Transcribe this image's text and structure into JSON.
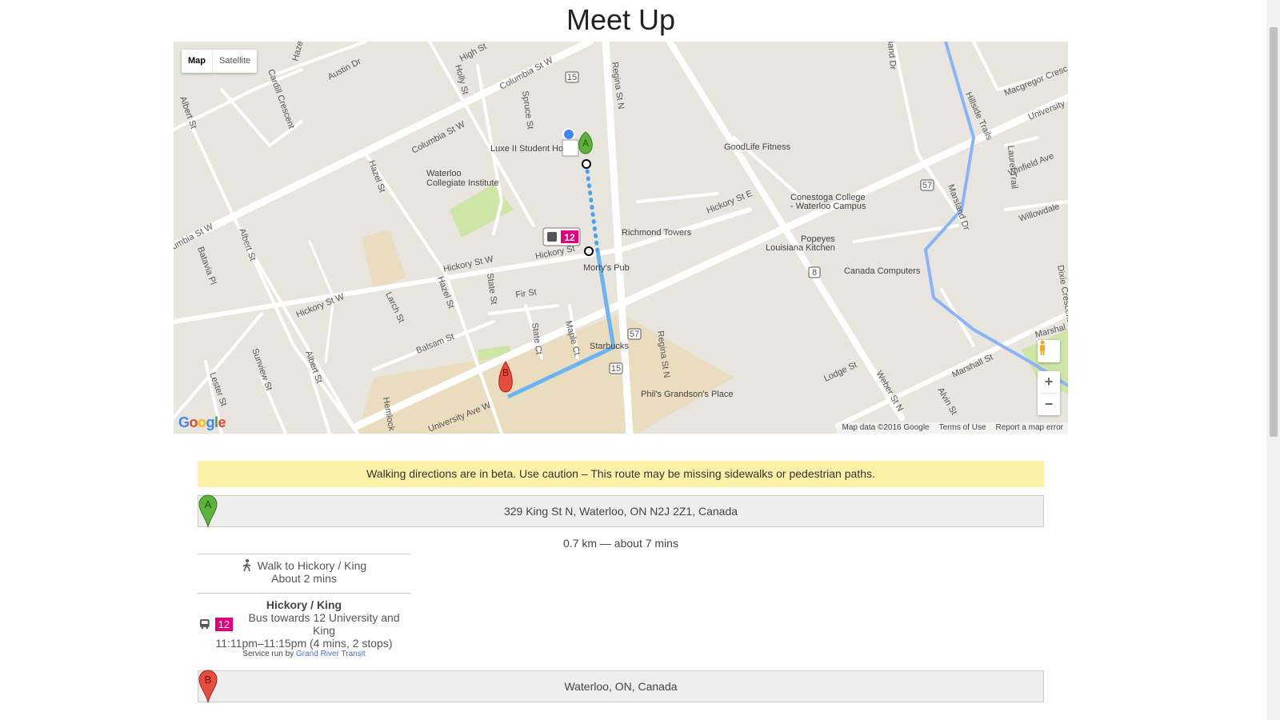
{
  "page": {
    "title": "Meet Up"
  },
  "map": {
    "type_control": {
      "map_label": "Map",
      "satellite_label": "Satellite",
      "selected": "Map"
    },
    "attribution": {
      "data": "Map data ©2016 Google",
      "terms": "Terms of Use",
      "report": "Report a map error"
    },
    "logo_text": [
      "G",
      "o",
      "o",
      "g",
      "l",
      "e"
    ],
    "zoom_in": "+",
    "zoom_out": "−",
    "bus_route_label": "12",
    "route_shield_15": "15",
    "route_shield_57": "57",
    "route_shield_8": "8",
    "marker_a": "A",
    "marker_b": "B",
    "streets": [
      "Hazel St",
      "Austin Dr",
      "High St",
      "Holly St",
      "Columbia St W",
      "Regina St N",
      "Spruce St",
      "Cardill Crescent",
      "Albert St",
      "Hazel St",
      "Waterloo Collegiate Institute",
      "Luxe II Student Ho",
      "GoodLife Fitness",
      "Columbia St W",
      "umbia St W",
      "Albert St",
      "Batavia Pl",
      "Hickory St W",
      "Hickory St",
      "Hickory St E",
      "Richmond Towers",
      "Conestoga College - Waterloo Campus",
      "Popeyes Louisiana Kitchen",
      "Canada Computers",
      "Morty's Pub",
      "State St",
      "Fir St",
      "Larch St",
      "Hickory St W",
      "Hazel St",
      "Balsam St",
      "State Ct",
      "Maple Ct",
      "Starbucks",
      "Regina St N",
      "Lester St",
      "Sunview St",
      "Albert St",
      "Hemlock",
      "University Ave W",
      "Phil's Grandson's Place",
      "Lodge St",
      "Weber St N",
      "Marshall St",
      "Alvin St",
      "Laurel Trail",
      "Marsland Dr",
      "Hillside Trails",
      "Macgregor Cresc",
      "University",
      "Winfield Ave",
      "Willowdale",
      "Dixie Crescent",
      "Marshal",
      "iand Dr"
    ]
  },
  "warning": "Walking directions are in beta. Use caution – This route may be missing sidewalks or pedestrian paths.",
  "origin": {
    "address": "329 King St N, Waterloo, ON N2J 2Z1, Canada",
    "pin": "A"
  },
  "summary": "0.7 km — about 7 mins",
  "steps": {
    "walk": {
      "text": "Walk to Hickory / King",
      "duration": "About 2 mins"
    },
    "transit": {
      "stop": "Hickory / King",
      "route": "12",
      "towards": "Bus towards 12 University and King",
      "times": "11:11pm–11:15pm (4 mins, 2 stops)",
      "service_prefix": "Service run by",
      "agency": "Grand River Transit"
    }
  },
  "destination": {
    "address": "Waterloo, ON, Canada",
    "pin": "B"
  },
  "colors": {
    "transit_badge": "#e4007c",
    "route_line": "#6ab3f4",
    "warning_bg": "#fcf1a6",
    "marker_a": "#5db33a",
    "marker_b": "#e74c3c"
  }
}
